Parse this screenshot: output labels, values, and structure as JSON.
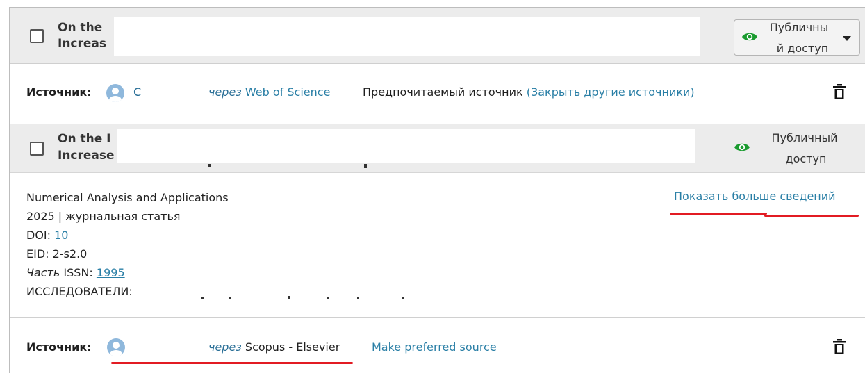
{
  "record1": {
    "title_line1": "On the",
    "title_line2": "Increas",
    "visibility_line1": "Публичны",
    "visibility_line2": "й доступ",
    "source_label": "Источник:",
    "source_name_partial": "С",
    "via_label": "через",
    "via_source": "Web of Science",
    "preferred_text": "Предпочитаемый источник",
    "close_other_link": "(Закрыть другие источники)"
  },
  "record2": {
    "title_line1": "On the I",
    "title_line2": "Increase",
    "visibility_line1": "Публичный",
    "visibility_line2": "доступ",
    "show_more_link": "Показать больше сведений",
    "journal": "Numerical Analysis and Applications",
    "year_type": "2025 | журнальная статья",
    "doi_label": "DOI:",
    "doi_value": "10",
    "eid_text": "EID: 2-s2.0",
    "part_label": "Часть",
    "issn_label": "ISSN:",
    "issn_value": "1995",
    "researchers_label": "ИССЛЕДОВАТЕЛИ:",
    "source_label": "Источник:",
    "via_label": "через",
    "via_source": "Scopus - Elsevier",
    "make_preferred_link": "Make preferred source"
  },
  "colors": {
    "accent_link": "#2a7fa6",
    "eye_green": "#1a9b2f",
    "annotation_red": "#e21b23"
  },
  "icons": [
    "eye-icon",
    "caret-down-icon",
    "avatar-icon",
    "trash-icon",
    "checkbox"
  ]
}
